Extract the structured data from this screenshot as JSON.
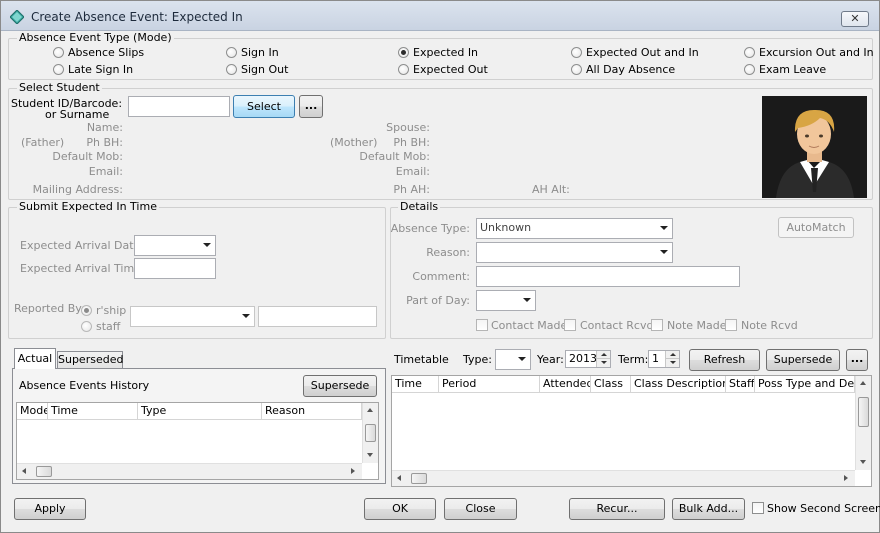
{
  "window": {
    "title": "Create Absence Event: Expected In",
    "close_label": "✕"
  },
  "mode": {
    "title": "Absence Event Type (Mode)",
    "options": [
      {
        "label": "Absence Slips",
        "selected": false
      },
      {
        "label": "Late Sign In",
        "selected": false
      },
      {
        "label": "Sign In",
        "selected": false
      },
      {
        "label": "Sign Out",
        "selected": false
      },
      {
        "label": "Expected In",
        "selected": true
      },
      {
        "label": "Expected Out",
        "selected": false
      },
      {
        "label": "Expected Out and In",
        "selected": false
      },
      {
        "label": "All Day Absence",
        "selected": false
      },
      {
        "label": "Excursion Out and In",
        "selected": false
      },
      {
        "label": "Exam Leave",
        "selected": false
      }
    ]
  },
  "student": {
    "title": "Select Student",
    "id_label_line1": "Student ID/Barcode:",
    "id_label_line2": "or Surname",
    "id_value": "",
    "select_label": "Select",
    "more_label": "...",
    "name_label": "Name:",
    "father_label": "(Father)",
    "ph_bh_label": "Ph BH:",
    "default_mob_label": "Default Mob:",
    "email_label": "Email:",
    "mailing_address_label": "Mailing Address:",
    "spouse_label": "Spouse:",
    "mother_label": "(Mother)",
    "ph_ah_label": "Ph AH:",
    "ah_alt_label": "AH Alt:"
  },
  "submit": {
    "title": "Submit Expected In Time",
    "arrival_date_label": "Expected Arrival Date:",
    "arrival_time_label": "Expected Arrival Time:",
    "reported_by_label": "Reported By:",
    "rship_label": "r'ship",
    "staff_label": "staff",
    "rship_selected": true
  },
  "details": {
    "title": "Details",
    "absence_type_label": "Absence Type:",
    "absence_type_value": "Unknown",
    "reason_label": "Reason:",
    "comment_label": "Comment:",
    "part_of_day_label": "Part of Day:",
    "automatch_label": "AutoMatch",
    "checks": [
      {
        "label": "Contact Made",
        "checked": false
      },
      {
        "label": "Contact Rcvd",
        "checked": false
      },
      {
        "label": "Note Made",
        "checked": false
      },
      {
        "label": "Note Rcvd",
        "checked": false
      }
    ]
  },
  "history": {
    "tabs": [
      "Actual",
      "Superseded"
    ],
    "active_tab": "Actual",
    "title": "Absence Events History",
    "supersede_label": "Supersede",
    "columns": [
      "Mode",
      "Time",
      "Type",
      "Reason"
    ]
  },
  "timetable": {
    "label": "Timetable",
    "type_label": "Type:",
    "year_label": "Year:",
    "year_value": "2013",
    "term_label": "Term:",
    "term_value": "1",
    "refresh_label": "Refresh",
    "supersede_label": "Supersede",
    "more_label": "...",
    "columns": [
      "Time",
      "Period",
      "Attended",
      "Class",
      "Class Description",
      "Staff",
      "Poss Type and Desc"
    ]
  },
  "footer": {
    "apply_label": "Apply",
    "ok_label": "OK",
    "close_label": "Close",
    "recur_label": "Recur...",
    "bulk_add_label": "Bulk Add...",
    "show_second_label": "Show Second Screen",
    "show_second_checked": false
  },
  "colors": {
    "title_gradient_top": "#dbe3ee",
    "button_focus": "#3c7fb1",
    "disabled_text": "#8d8d8d"
  }
}
